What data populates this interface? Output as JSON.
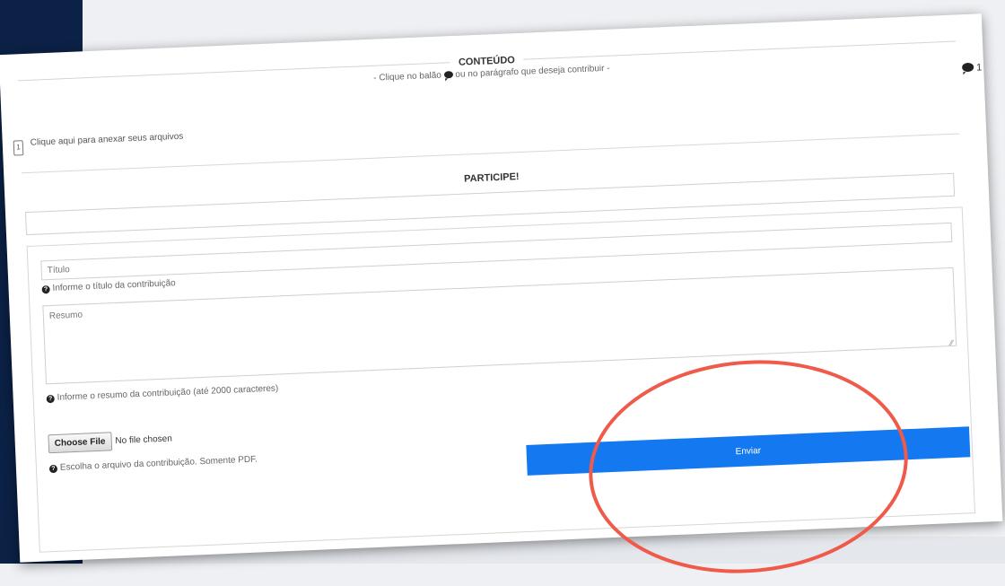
{
  "content": {
    "heading": "CONTEÚDO",
    "subtitle_before": "- Clique no balão",
    "subtitle_after": "ou no parágrafo que deseja contribuir -",
    "comment_count": "1"
  },
  "attach": {
    "icon_label": "1",
    "text": "Clique aqui para anexar seus arquivos"
  },
  "participe": {
    "heading": "PARTICIPE!"
  },
  "form": {
    "title_placeholder": "Título",
    "title_help": "Informe o título da contribuição",
    "summary_placeholder": "Resumo",
    "summary_help": "Informe o resumo da contribuição (até 2000 caracteres)",
    "file_button": "Choose File",
    "file_status": "No file chosen",
    "file_help": "Escolha o arquivo da contribuição. Somente PDF.",
    "submit": "Enviar"
  },
  "colors": {
    "sidebar": "#0b2146",
    "primary_button": "#1479f0",
    "annotation": "#f05a4a"
  },
  "icons": [
    "comment-bubble-icon",
    "attachment-icon",
    "question-circle-icon",
    "resize-grip-icon"
  ]
}
